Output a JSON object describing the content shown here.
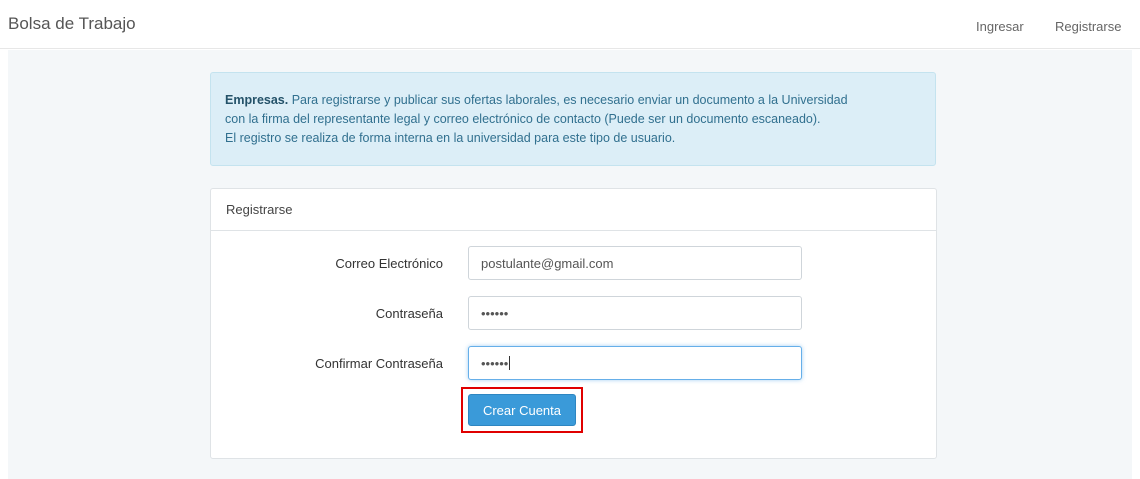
{
  "navbar": {
    "brand": "Bolsa de Trabajo",
    "login": "Ingresar",
    "register": "Registrarse"
  },
  "alert": {
    "bold": "Empresas.",
    "line1": " Para registrarse y publicar sus ofertas laborales, es necesario enviar un documento a la Universidad",
    "line2": "con la firma del representante legal y correo electrónico de contacto (Puede ser un documento escaneado).",
    "line3": "El registro se realiza de forma interna en la universidad para este tipo de usuario."
  },
  "panel": {
    "title": "Registrarse",
    "email_label": "Correo Electrónico",
    "email_value": "postulante@gmail.com",
    "password_label": "Contraseña",
    "password_value": "••••••",
    "confirm_label": "Confirmar Contraseña",
    "confirm_value": "••••••",
    "submit": "Crear Cuenta"
  },
  "colors": {
    "accent": "#3a9ad9",
    "alert_bg": "#dceef7",
    "highlight": "#e00000"
  }
}
